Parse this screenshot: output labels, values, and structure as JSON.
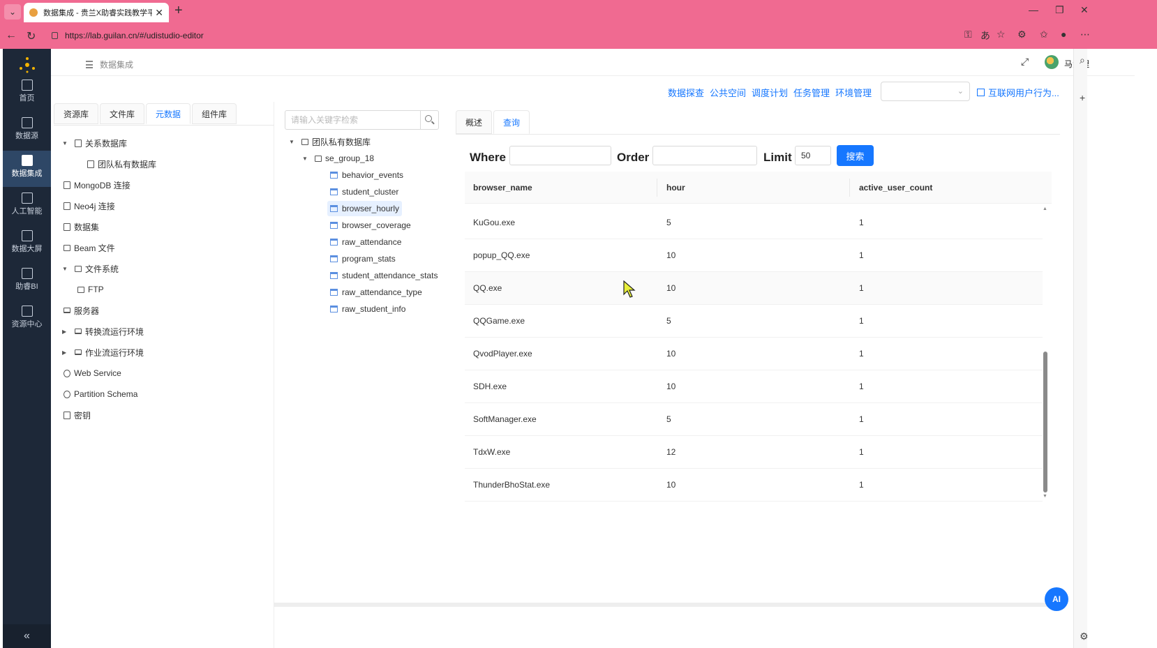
{
  "browser": {
    "tab_title": "数据集成 - 贵兰X助睿实践教学平台",
    "url": "https://lab.guilan.cn/#/udistudio-editor",
    "new_tab": "+",
    "close": "✕",
    "minimize": "—",
    "restore": "❐",
    "win_close": "✕"
  },
  "sidebar": {
    "items": [
      {
        "label": "首页",
        "icon": "home-icon"
      },
      {
        "label": "数据源",
        "icon": "database-icon"
      },
      {
        "label": "数据集成",
        "icon": "data-integration-icon"
      },
      {
        "label": "人工智能",
        "icon": "ai-icon"
      },
      {
        "label": "数据大屏",
        "icon": "chart-icon"
      },
      {
        "label": "助睿BI",
        "icon": "bi-icon"
      },
      {
        "label": "资源中心",
        "icon": "resource-icon"
      }
    ],
    "active_index": 2,
    "collapse": "«"
  },
  "header": {
    "breadcrumb": "数据集成",
    "username": "马源理",
    "fullscreen": "⤢"
  },
  "toplinks": [
    "数据探查",
    "公共空间",
    "调度计划",
    "任务管理",
    "环境管理"
  ],
  "project_link": "互联网用户行为...",
  "left_tabs": [
    "资源库",
    "文件库",
    "元数据",
    "组件库"
  ],
  "left_tabs_active": 2,
  "tree": [
    {
      "label": "关系数据库",
      "caret": "▼"
    },
    {
      "label": "团队私有数据库",
      "caret": ""
    },
    {
      "label": "MongoDB 连接",
      "caret": ""
    },
    {
      "label": "Neo4j 连接",
      "caret": ""
    },
    {
      "label": "数据集",
      "caret": ""
    },
    {
      "label": "Beam 文件",
      "caret": ""
    },
    {
      "label": "文件系统",
      "caret": "▼"
    },
    {
      "label": "FTP",
      "caret": ""
    },
    {
      "label": "服务器",
      "caret": ""
    },
    {
      "label": "转换流运行环境",
      "caret": "▶"
    },
    {
      "label": "作业流运行环境",
      "caret": "▶"
    },
    {
      "label": "Web Service",
      "caret": ""
    },
    {
      "label": "Partition Schema",
      "caret": ""
    },
    {
      "label": "密钥",
      "caret": ""
    }
  ],
  "mid": {
    "search_placeholder": "请输入关键字检索",
    "root": "团队私有数据库",
    "group": "se_group_18",
    "tables": [
      "behavior_events",
      "student_cluster",
      "browser_hourly",
      "browser_coverage",
      "raw_attendance",
      "program_stats",
      "student_attendance_stats",
      "raw_attendance_type",
      "raw_student_info"
    ],
    "selected_table": "browser_hourly"
  },
  "right": {
    "tabs": [
      "概述",
      "查询"
    ],
    "active_tab": 1,
    "where_label": "Where",
    "order_label": "Order",
    "limit_label": "Limit",
    "where_value": "",
    "order_value": "",
    "limit_value": "50",
    "search_button": "搜索",
    "columns": [
      "browser_name",
      "hour",
      "active_user_count"
    ],
    "rows": [
      [
        "KuGou.exe",
        "5",
        "1"
      ],
      [
        "popup_QQ.exe",
        "10",
        "1"
      ],
      [
        "QQ.exe",
        "10",
        "1"
      ],
      [
        "QQGame.exe",
        "5",
        "1"
      ],
      [
        "QvodPlayer.exe",
        "10",
        "1"
      ],
      [
        "SDH.exe",
        "10",
        "1"
      ],
      [
        "SoftManager.exe",
        "5",
        "1"
      ],
      [
        "TdxW.exe",
        "12",
        "1"
      ],
      [
        "ThunderBhoStat.exe",
        "10",
        "1"
      ]
    ]
  },
  "ai_button": "AI",
  "colors": {
    "accent": "#1677ff",
    "tabbar": "#f06a91",
    "sidebar": "#1d2838"
  }
}
